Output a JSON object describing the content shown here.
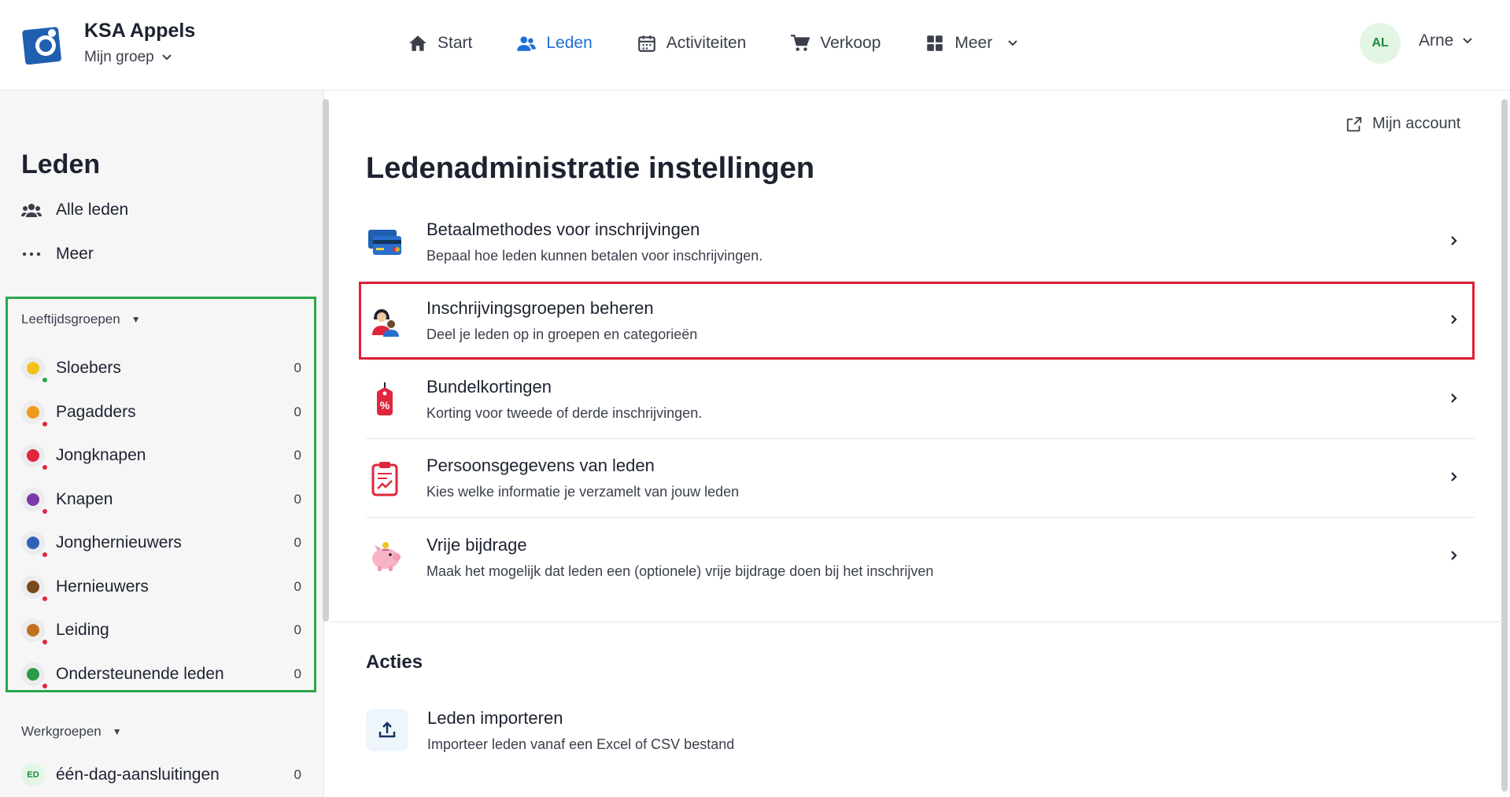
{
  "header": {
    "org_name": "KSA Appels",
    "group_selector": "Mijn groep",
    "nav": [
      {
        "label": "Start",
        "icon": "home-icon"
      },
      {
        "label": "Leden",
        "icon": "users-icon",
        "active": true
      },
      {
        "label": "Activiteiten",
        "icon": "calendar-icon"
      },
      {
        "label": "Verkoop",
        "icon": "cart-icon"
      },
      {
        "label": "Meer",
        "icon": "grid-icon"
      }
    ],
    "avatar_initials": "AL",
    "user_name": "Arne"
  },
  "sidebar": {
    "title": "Leden",
    "links": [
      {
        "label": "Alle leden",
        "icon": "users-icon"
      },
      {
        "label": "Meer",
        "icon": "ellipsis-icon"
      }
    ],
    "age_groups_heading": "Leeftijdsgroepen",
    "age_groups": [
      {
        "label": "Sloebers",
        "count": "0",
        "color": "#f2c21b",
        "dot": "green"
      },
      {
        "label": "Pagadders",
        "count": "0",
        "color": "#f09a1a",
        "dot": "red"
      },
      {
        "label": "Jongknapen",
        "count": "0",
        "color": "#e0263d",
        "dot": "red"
      },
      {
        "label": "Knapen",
        "count": "0",
        "color": "#7a3aa8",
        "dot": "red"
      },
      {
        "label": "Jonghernieuwers",
        "count": "0",
        "color": "#2f63b8",
        "dot": "red"
      },
      {
        "label": "Hernieuwers",
        "count": "0",
        "color": "#7a4a1f",
        "dot": "red"
      },
      {
        "label": "Leiding",
        "count": "0",
        "color": "#c2701f",
        "dot": "red"
      },
      {
        "label": "Ondersteunende leden",
        "count": "0",
        "color": "#2a9a4a",
        "dot": "red"
      }
    ],
    "work_groups_heading": "Werkgroepen",
    "work_groups": [
      {
        "label": "één-dag-aansluitingen",
        "count": "0",
        "badge": "ED"
      }
    ]
  },
  "main": {
    "my_account": "Mijn account",
    "title": "Ledenadministratie instellingen",
    "settings": [
      {
        "title": "Betaalmethodes voor inschrijvingen",
        "desc": "Bepaal hoe leden kunnen betalen voor inschrijvingen.",
        "icon": "credit-card-icon"
      },
      {
        "title": "Inschrijvingsgroepen beheren",
        "desc": "Deel je leden op in groepen en categorieën",
        "icon": "group-people-icon"
      },
      {
        "title": "Bundelkortingen",
        "desc": "Korting voor tweede of derde inschrijvingen.",
        "icon": "discount-tag-icon"
      },
      {
        "title": "Persoonsgegevens van leden",
        "desc": "Kies welke informatie je verzamelt van jouw leden",
        "icon": "clipboard-icon"
      },
      {
        "title": "Vrije bijdrage",
        "desc": "Maak het mogelijk dat leden een (optionele) vrije bijdrage doen bij het inschrijven",
        "icon": "piggy-bank-icon"
      }
    ],
    "actions_heading": "Acties",
    "actions": [
      {
        "title": "Leden importeren",
        "desc": "Importeer leden vanaf een Excel of CSV bestand",
        "icon": "upload-icon"
      }
    ]
  },
  "colors": {
    "accent": "#1e6fd6",
    "highlight_red": "#e01e36",
    "highlight_green": "#2aa64a"
  }
}
